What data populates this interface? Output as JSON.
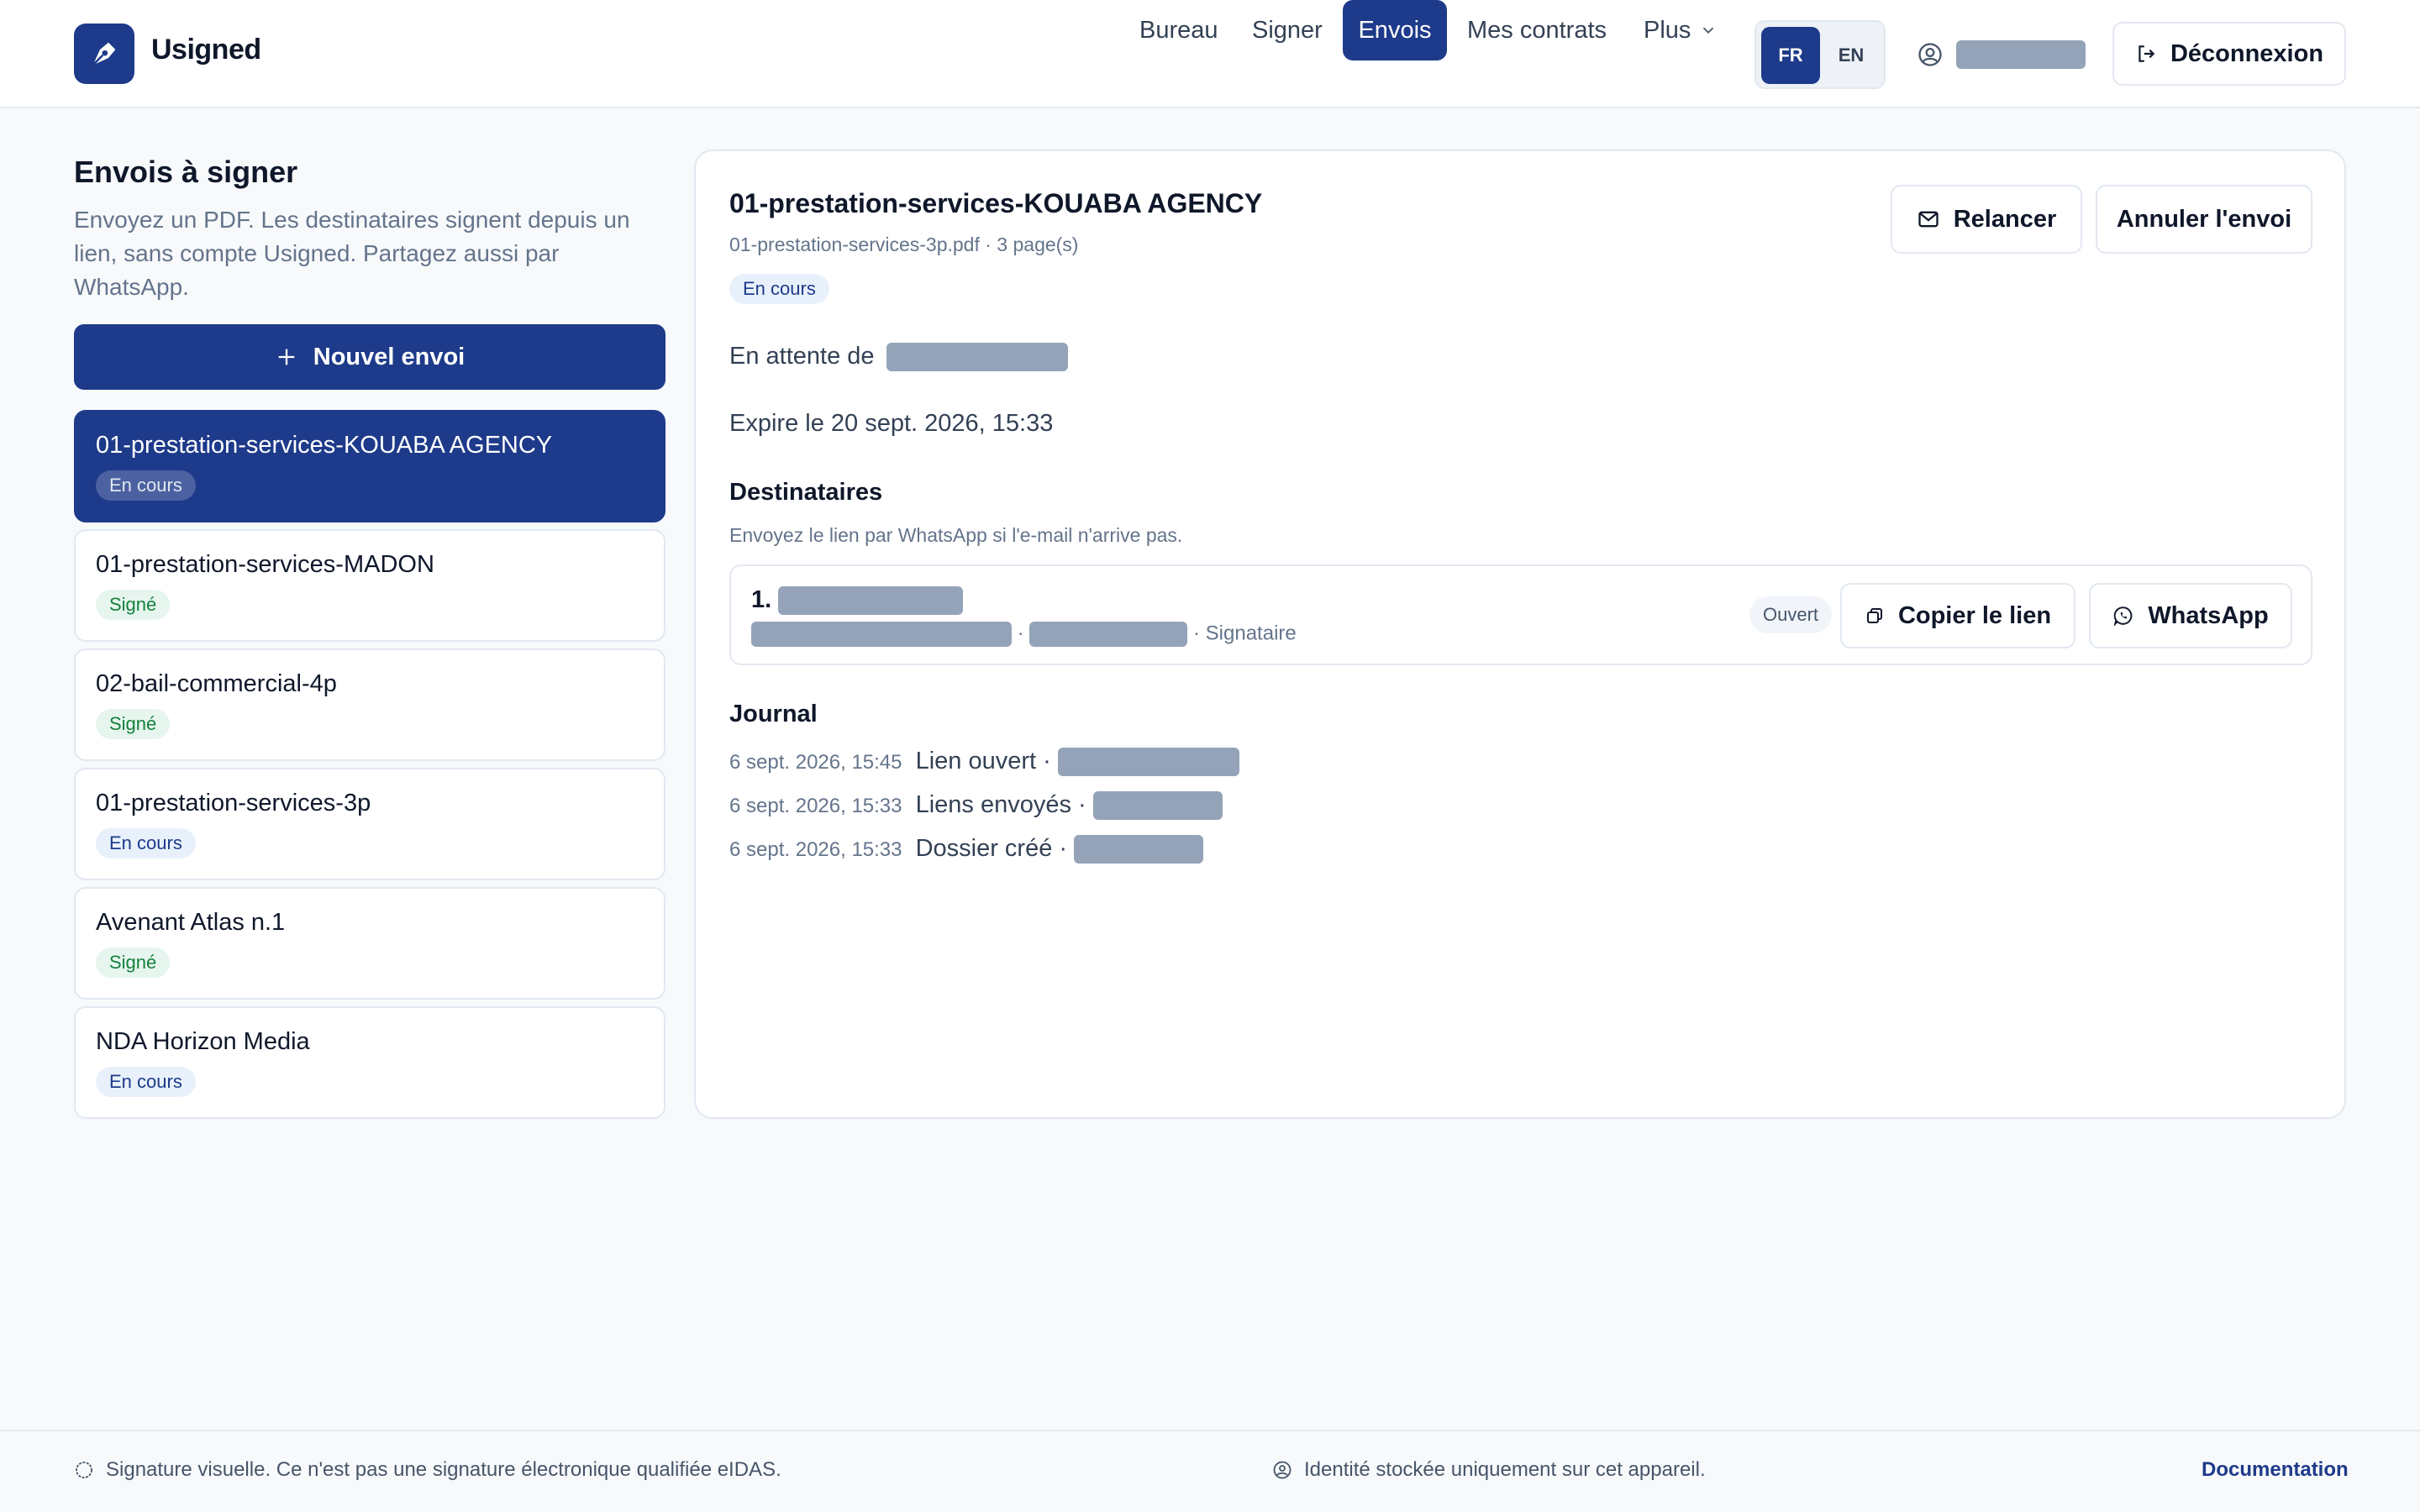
{
  "app": {
    "name": "Usigned"
  },
  "nav": {
    "items": [
      "Bureau",
      "Signer",
      "Envois",
      "Mes contrats",
      "Plus"
    ],
    "active": "Envois"
  },
  "lang": {
    "fr": "FR",
    "en": "EN",
    "active": "FR"
  },
  "header": {
    "logout_label": "Déconnexion"
  },
  "sidebar": {
    "title": "Envois à signer",
    "description": "Envoyez un PDF. Les destinataires signent depuis un lien, sans compte Usigned. Partagez aussi par WhatsApp.",
    "new_button": "Nouvel envoi",
    "items": [
      {
        "name": "01-prestation-services-KOUABA AGENCY",
        "status": "En cours",
        "status_kind": "encours",
        "selected": true
      },
      {
        "name": "01-prestation-services-MADON",
        "status": "Signé",
        "status_kind": "signe"
      },
      {
        "name": "02-bail-commercial-4p",
        "status": "Signé",
        "status_kind": "signe"
      },
      {
        "name": "01-prestation-services-3p",
        "status": "En cours",
        "status_kind": "encours"
      },
      {
        "name": "Avenant Atlas n.1",
        "status": "Signé",
        "status_kind": "signe"
      },
      {
        "name": "NDA Horizon Media",
        "status": "En cours",
        "status_kind": "encours"
      }
    ]
  },
  "detail": {
    "title": "01-prestation-services-KOUABA AGENCY",
    "file": "01-prestation-services-3p.pdf · 3 page(s)",
    "status": "En cours",
    "remind_button": "Relancer",
    "cancel_button": "Annuler l'envoi",
    "waiting_label": "En attente de",
    "expires": "Expire le 20 sept. 2026, 15:33",
    "recipients_heading": "Destinataires",
    "recipients_hint": "Envoyez le lien par WhatsApp si l'e-mail n'arrive pas.",
    "recipient": {
      "index": "1.",
      "role": "· Signataire",
      "status": "Ouvert",
      "copy_button": "Copier le lien",
      "whatsapp_button": "WhatsApp"
    },
    "journal_heading": "Journal",
    "journal": [
      {
        "time": "6 sept. 2026, 15:45",
        "event": "Lien ouvert ·"
      },
      {
        "time": "6 sept. 2026, 15:33",
        "event": "Liens envoyés ·"
      },
      {
        "time": "6 sept. 2026, 15:33",
        "event": "Dossier créé ·"
      }
    ]
  },
  "footer": {
    "notice": "Signature visuelle. Ce n'est pas une signature électronique qualifiée eIDAS.",
    "identity": "Identité stockée uniquement sur cet appareil.",
    "docs_link": "Documentation"
  },
  "colors": {
    "primary": "#1e3a8a",
    "background": "#f7f9fb",
    "redacted": "#94a3b8",
    "signed_badge": "#15803d"
  }
}
